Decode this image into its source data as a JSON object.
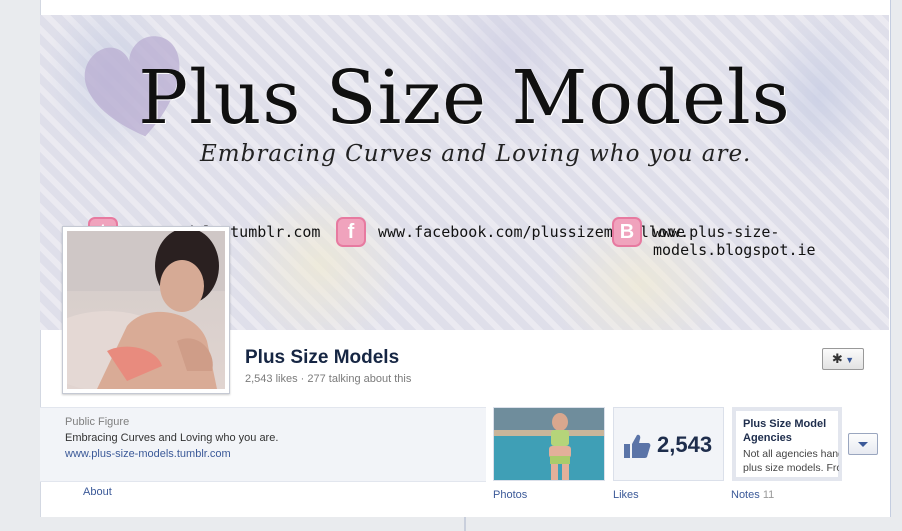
{
  "cover": {
    "title": "Plus Size Models",
    "tagline": "Embracing Curves and Loving who you are.",
    "links": [
      {
        "icon": "tumblr-icon",
        "text": "dels.tumblr.com"
      },
      {
        "icon": "facebook-icon",
        "text": "www.facebook.com/plussizemodellove"
      },
      {
        "icon": "blogger-icon",
        "text": "www.plus-size-models.blogspot.ie"
      }
    ]
  },
  "header": {
    "name": "Plus Size Models",
    "stats": "2,543 likes · 277 talking about this",
    "settings_icon": "gear-icon"
  },
  "info": {
    "category": "Public Figure",
    "description": "Embracing Curves and Loving who you are.",
    "url": "www.plus-size-models.tumblr.com",
    "about_label": "About"
  },
  "apps": {
    "photos_label": "Photos",
    "likes_label": "Likes",
    "likes_count": "2,543",
    "notes_label": "Notes",
    "notes_count": "11",
    "notes_title": "Plus Size Model Agencies",
    "notes_preview_1": "Not all agencies hand",
    "notes_preview_2": "plus size models. Fro"
  },
  "colors": {
    "link": "#3b5998",
    "name": "#162643",
    "badge_pink": "#f0a3bd"
  }
}
